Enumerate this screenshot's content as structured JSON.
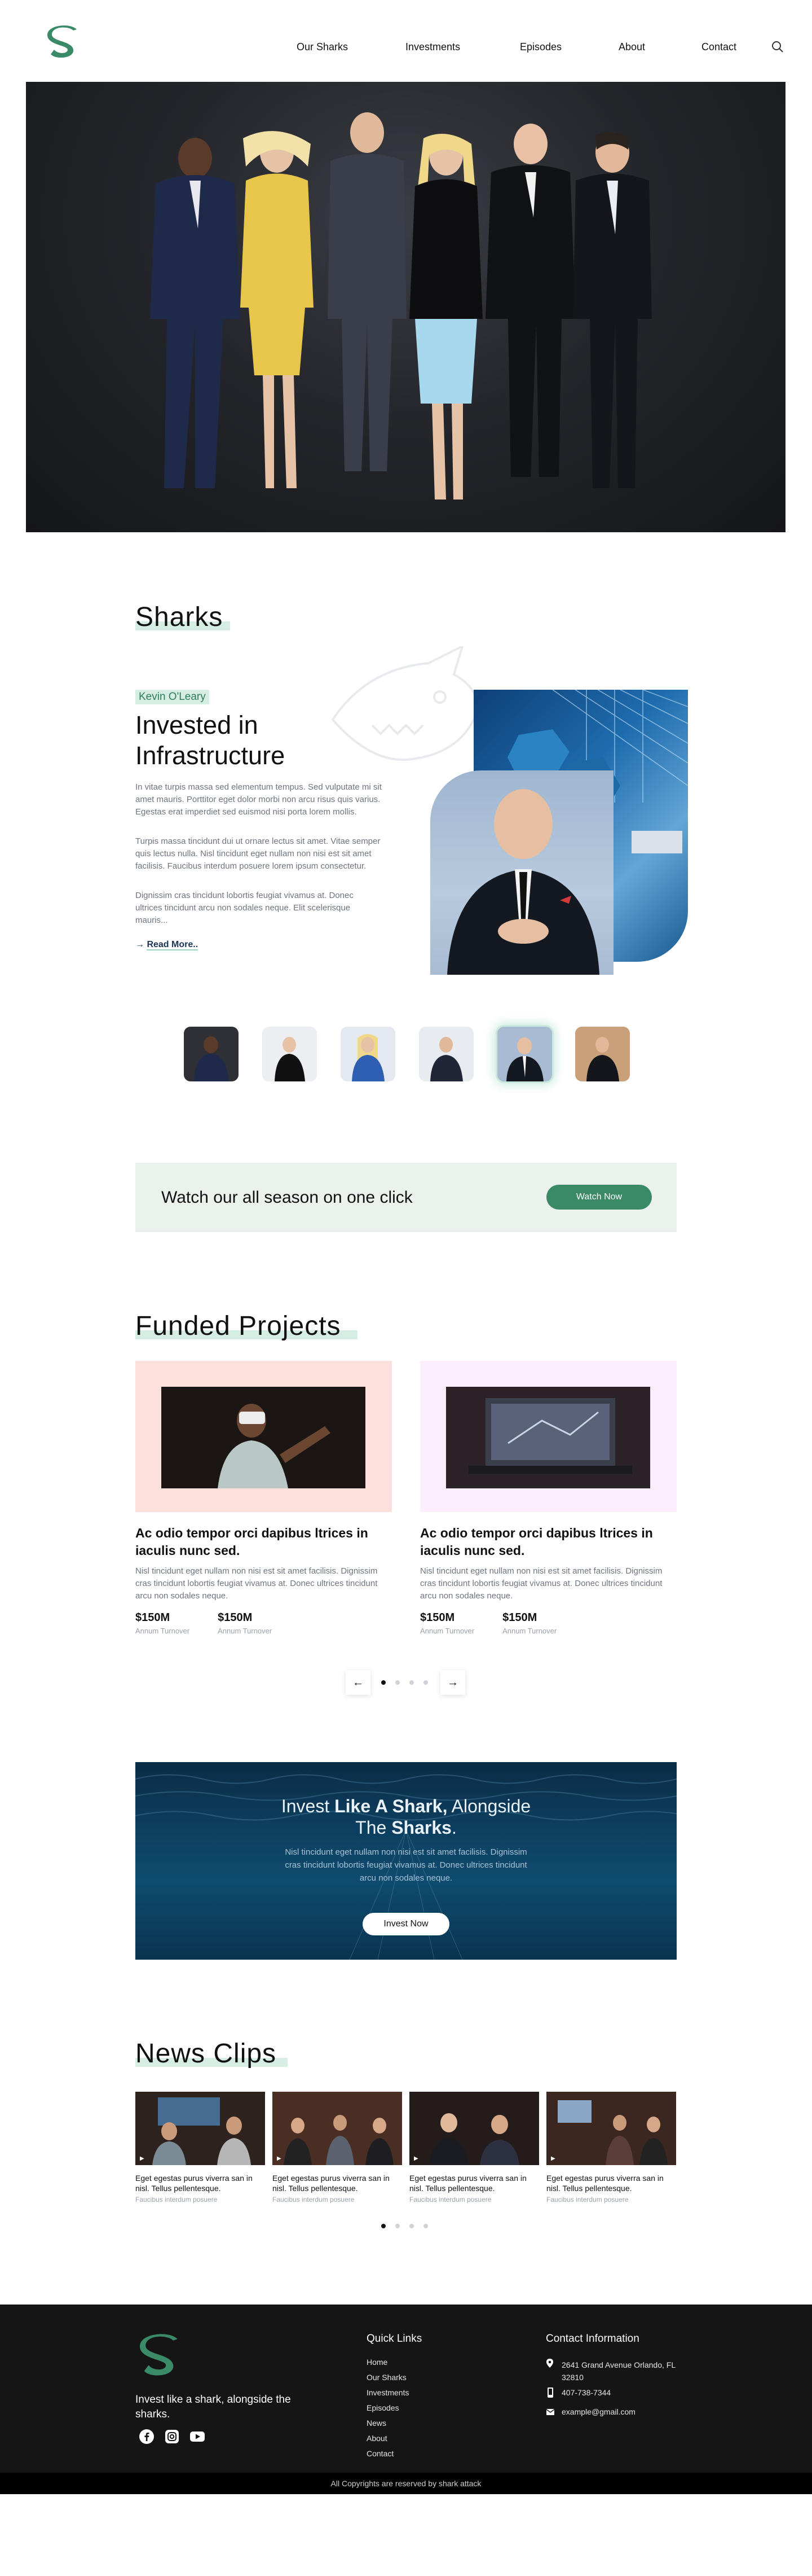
{
  "colors": {
    "brand_green": "#3a8a67",
    "tag_bg": "#d6ede4",
    "footer_bg": "#151515"
  },
  "nav": {
    "logo_icon": "s-logo-icon",
    "items": [
      "Our Sharks",
      "Investments",
      "Episodes",
      "About",
      "Contact"
    ],
    "search_icon": "search-icon"
  },
  "sharks": {
    "title": "Sharks",
    "featured": {
      "tag": "Kevin O'Leary",
      "title": "Invested in Infrastructure",
      "paragraphs": [
        "In vitae turpis massa sed elementum tempus. Sed vulputate mi sit amet mauris. Porttitor eget dolor morbi non arcu risus quis varius. Egestas erat imperdiet sed euismod nisi porta lorem mollis.",
        "Turpis massa tincidunt dui ut ornare lectus sit amet. Vitae semper quis lectus nulla. Nisl tincidunt eget nullam non nisi est sit amet facilisis. Faucibus interdum posuere lorem ipsum consectetur.",
        "Dignissim cras tincidunt lobortis feugiat vivamus at. Donec ultrices tincidunt arcu non sodales neque. Elit scelerisque mauris..."
      ],
      "read_more": "Read More.."
    },
    "selected_index": 4
  },
  "watch": {
    "text": "Watch our all season on one click",
    "button": "Watch Now"
  },
  "funded": {
    "title": "Funded Projects",
    "projects": [
      {
        "title": "Ac odio tempor orci dapibus ltrices in iaculis nunc sed.",
        "desc": "Nisl tincidunt eget nullam non nisi est sit amet facilisis. Dignissim cras tincidunt lobortis feugiat vivamus at. Donec ultrices tincidunt arcu non sodales neque.",
        "stats": [
          {
            "value": "$150M",
            "label": "Annum Turnover"
          },
          {
            "value": "$150M",
            "label": "Annum Turnover"
          }
        ],
        "bg": "#fde0dc"
      },
      {
        "title": "Ac odio tempor orci dapibus ltrices in iaculis nunc sed.",
        "desc": "Nisl tincidunt eget nullam non nisi est sit amet facilisis. Dignissim cras tincidunt lobortis feugiat vivamus at. Donec ultrices tincidunt arcu non sodales neque.",
        "stats": [
          {
            "value": "$150M",
            "label": "Annum Turnover"
          },
          {
            "value": "$150M",
            "label": "Annum Turnover"
          }
        ],
        "bg": "#fdeefd"
      }
    ],
    "active_page": 1,
    "page_count": 4
  },
  "invest": {
    "line1_pre": "Invest ",
    "line1_bold": "Like A Shark,",
    "line1_post": " Alongside",
    "line2_pre": "The ",
    "line2_bold": "Sharks",
    "line2_post": ".",
    "paragraph": "Nisl tincidunt eget nullam non nisi est sit amet facilisis. Dignissim cras tincidunt lobortis feugiat vivamus at. Donec ultrices tincidunt arcu non sodales neque.",
    "button": "Invest Now"
  },
  "news": {
    "title": "News Clips",
    "clips": [
      {
        "title": "Eget egestas purus viverra san in nisl. Tellus pellentesque.",
        "sub": "Faucibus interdum posuere"
      },
      {
        "title": "Eget egestas purus viverra san in nisl. Tellus pellentesque.",
        "sub": "Faucibus interdum posuere"
      },
      {
        "title": "Eget egestas purus viverra san in nisl. Tellus pellentesque.",
        "sub": "Faucibus interdum posuere"
      },
      {
        "title": "Eget egestas purus viverra san in nisl. Tellus pellentesque.",
        "sub": "Faucibus interdum posuere"
      }
    ],
    "active_page": 1,
    "page_count": 4
  },
  "footer": {
    "tagline": "Invest like a shark, alongside the sharks.",
    "social_icons": [
      "facebook-icon",
      "instagram-icon",
      "youtube-icon"
    ],
    "quick_links_title": "Quick Links",
    "quick_links": [
      "Home",
      "Our Sharks",
      "Investments",
      "Episodes",
      "News",
      "About",
      "Contact"
    ],
    "contact_title": "Contact Information",
    "address": "2641 Grand Avenue Orlando, FL 32810",
    "phone": "407-738-7344",
    "email": "example@gmail.com",
    "copyright": "All Copyrights are reserved by shark attack"
  }
}
